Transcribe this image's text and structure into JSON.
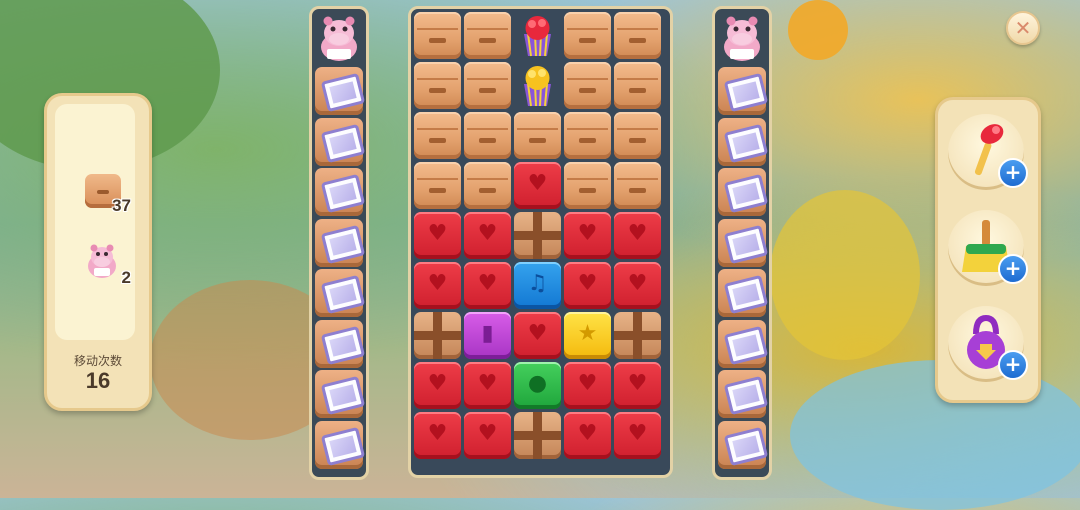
{
  "goals": {
    "items": [
      {
        "icon": "crate-goal-icon",
        "count": "37"
      },
      {
        "icon": "hippo-goal-icon",
        "count": "2"
      }
    ],
    "moves_label": "移动次数",
    "moves_value": "16"
  },
  "close_label": "✕",
  "boosters": [
    {
      "name": "hammer-icon",
      "plus": "+"
    },
    {
      "name": "broom-icon",
      "plus": "+"
    },
    {
      "name": "kettlebell-icon",
      "plus": "+"
    }
  ],
  "side_columns": {
    "cells_per_column": 8,
    "item_icon": "envelope-block-icon",
    "head_icon": "hippo-icon"
  },
  "board": {
    "columns": 5,
    "rows": 9,
    "grid": [
      [
        "crate",
        "crate",
        "cupcake",
        "crate",
        "crate"
      ],
      [
        "crate",
        "crate",
        "cupcake",
        "crate",
        "crate"
      ],
      [
        "crate",
        "crate",
        "crate",
        "crate",
        "crate"
      ],
      [
        "crate",
        "crate",
        "red",
        "crate",
        "crate"
      ],
      [
        "red",
        "red",
        "package",
        "red",
        "red"
      ],
      [
        "red",
        "red",
        "blue",
        "red",
        "red"
      ],
      [
        "package",
        "purple",
        "red",
        "yellow",
        "package"
      ],
      [
        "red",
        "red",
        "green",
        "red",
        "red"
      ],
      [
        "red",
        "red",
        "package",
        "red",
        "red"
      ]
    ],
    "symbols": {
      "red": "♥",
      "blue": "♫",
      "purple": "▮",
      "yellow": "★",
      "green": "●"
    }
  }
}
